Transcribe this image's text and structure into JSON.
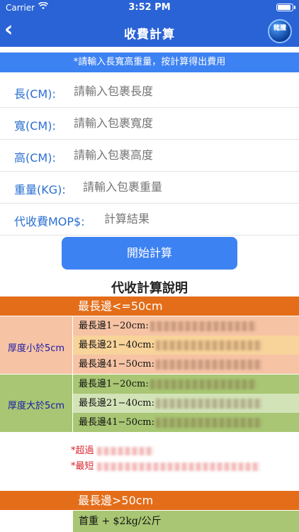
{
  "status": {
    "carrier": "Carrier",
    "time": "3:52 PM"
  },
  "nav": {
    "title": "收費計算",
    "logo_text": "龍騰"
  },
  "notice": "*請輸入長寬高重量，按計算得出費用",
  "form": [
    {
      "label": "長(CM):",
      "placeholder": "請輸入包裹長度"
    },
    {
      "label": "寬(CM):",
      "placeholder": "請輸入包裹寬度"
    },
    {
      "label": "高(CM):",
      "placeholder": "請輸入包裹高度"
    },
    {
      "label": "重量(KG):",
      "placeholder": "請輸入包裹重量"
    },
    {
      "label": "代收費MOP$:",
      "placeholder": "計算結果"
    }
  ],
  "calc_button": "開始計算",
  "explain_title": "代收計算說明",
  "band1": "最長邊<=50cm",
  "group_thin": {
    "label": "厚度小於5cm",
    "rows": [
      "最長邊1−20cm:",
      "最長邊21−40cm:",
      "最長邊41−50cm:"
    ]
  },
  "group_thick": {
    "label": "厚度大於5cm",
    "rows": [
      "最長邊1−20cm:",
      "最長邊21−40cm:",
      "最長邊41−50cm:"
    ]
  },
  "notes": [
    "*超過",
    "*最短"
  ],
  "band2": "最長邊>50cm",
  "footer": "首重 + $2kg/公斤",
  "colors": {
    "nav_bg": "#2a63d6",
    "accent_blue": "#3d82f2",
    "band_orange": "#e36d19",
    "thin_bg": "#f6c3a4",
    "thick_bg": "#a8c673",
    "label_blue": "#2a6fd1",
    "note_red": "#d8262c"
  }
}
